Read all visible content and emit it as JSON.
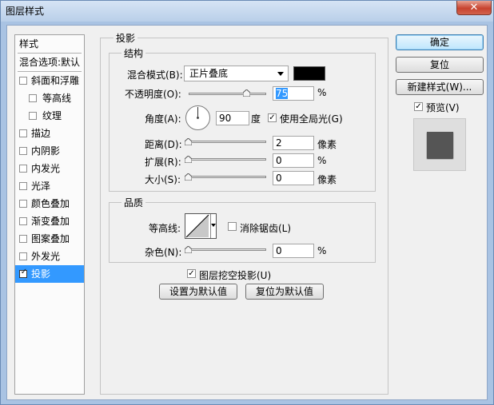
{
  "window": {
    "title": "图层样式",
    "close_symbol": "✕"
  },
  "styles_list": {
    "header": "样式",
    "blend_item": "混合选项:默认",
    "items": [
      {
        "label": "斜面和浮雕",
        "checked": false,
        "sub": false
      },
      {
        "label": "等高线",
        "checked": false,
        "sub": true
      },
      {
        "label": "纹理",
        "checked": false,
        "sub": true
      },
      {
        "label": "描边",
        "checked": false,
        "sub": false
      },
      {
        "label": "内阴影",
        "checked": false,
        "sub": false
      },
      {
        "label": "内发光",
        "checked": false,
        "sub": false
      },
      {
        "label": "光泽",
        "checked": false,
        "sub": false
      },
      {
        "label": "颜色叠加",
        "checked": false,
        "sub": false
      },
      {
        "label": "渐变叠加",
        "checked": false,
        "sub": false
      },
      {
        "label": "图案叠加",
        "checked": false,
        "sub": false
      },
      {
        "label": "外发光",
        "checked": false,
        "sub": false
      },
      {
        "label": "投影",
        "checked": true,
        "sub": false,
        "selected": true
      }
    ]
  },
  "drop_shadow": {
    "title": "投影",
    "structure": {
      "title": "结构",
      "blend_mode_label": "混合模式(B):",
      "blend_mode_value": "正片叠底",
      "blend_color": "#000000",
      "opacity_label": "不透明度(O):",
      "opacity_value": "75",
      "opacity_unit": "%",
      "opacity_level": 0.75,
      "angle_label": "角度(A):",
      "angle_value": "90",
      "angle_unit": "度",
      "global_light_label": "使用全局光(G)",
      "global_light_checked": true,
      "distance_label": "距离(D):",
      "distance_value": "2",
      "distance_unit": "像素",
      "spread_label": "扩展(R):",
      "spread_value": "0",
      "spread_unit": "%",
      "size_label": "大小(S):",
      "size_value": "0",
      "size_unit": "像素"
    },
    "quality": {
      "title": "品质",
      "contour_label": "等高线:",
      "antialias_label": "消除锯齿(L)",
      "antialias_checked": false,
      "noise_label": "杂色(N):",
      "noise_value": "0",
      "noise_unit": "%"
    },
    "knockout_label": "图层挖空投影(U)",
    "knockout_checked": true,
    "make_default": "设置为默认值",
    "reset_default": "复位为默认值"
  },
  "buttons": {
    "ok": "确定",
    "reset": "复位",
    "new_style": "新建样式(W)...",
    "preview_label": "预览(V)",
    "preview_checked": true
  },
  "check_glyph": "✓"
}
